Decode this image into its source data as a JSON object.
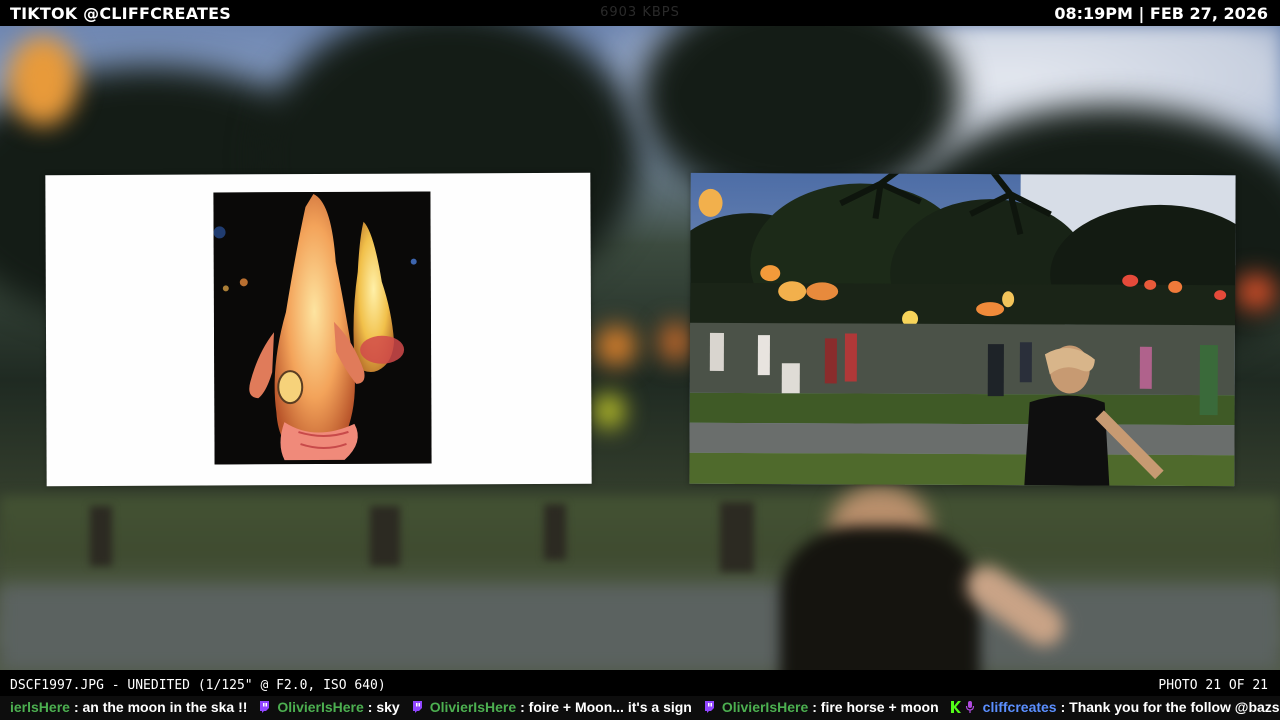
{
  "top": {
    "channel": "TIKTOK @CLIFFCREATES",
    "bitrate": "6903 KBPS",
    "datetime": "08:19PM | FEB 27, 2026"
  },
  "photo_info": {
    "filename_line": "DSCF1997.JPG - UNEDITED (1/125\" @ F2.0, ISO 640)",
    "counter": "PHOTO 21 OF 21"
  },
  "chat": [
    {
      "user": "ierlsHere",
      "text": ": an the moon in the ska !!",
      "badge": "none",
      "role": "viewer"
    },
    {
      "user": "OlivierIsHere",
      "text": ": sky",
      "badge": "twitch",
      "role": "viewer"
    },
    {
      "user": "OlivierIsHere",
      "text": ": foire + Moon... it's a sign",
      "badge": "twitch",
      "role": "viewer"
    },
    {
      "user": "OlivierIsHere",
      "text": ": fire horse + moon",
      "badge": "twitch",
      "role": "viewer"
    },
    {
      "user": "cliffcreates",
      "text": ": Thank you for the follow @bazsikonin",
      "badge": "kick-mic",
      "role": "host"
    }
  ],
  "colors": {
    "viewer_name": "#4caf50",
    "host_name": "#5b8fff",
    "twitch_badge": "#9146ff",
    "kick_badge": "#53fc18"
  }
}
